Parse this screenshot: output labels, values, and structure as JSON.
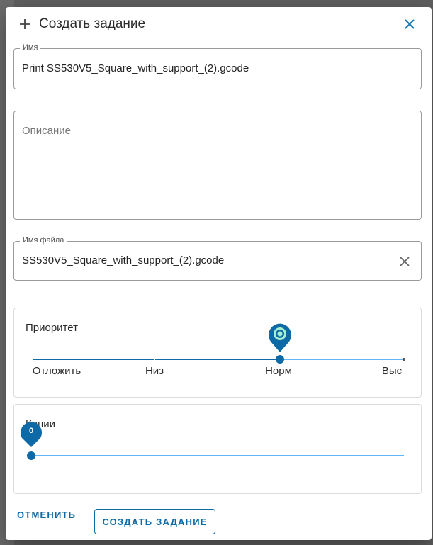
{
  "dialog": {
    "title": "Создать задание"
  },
  "fields": {
    "name": {
      "legend": "Имя",
      "value": "Print SS530V5_Square_with_support_(2).gcode"
    },
    "description": {
      "placeholder": "Описание",
      "value": ""
    },
    "filename": {
      "legend": "Имя файла",
      "value": "SS530V5_Square_with_support_(2).gcode"
    }
  },
  "priority": {
    "label": "Приоритет",
    "marks": [
      "Отложить",
      "Низ",
      "Норм",
      "Выс"
    ],
    "selected": "Норм",
    "level": 2
  },
  "copies": {
    "label": "Копии",
    "value": "0",
    "min": 0
  },
  "actions": {
    "cancel": "ОТМЕНИТЬ",
    "create": "СОЗДАТЬ ЗАДАНИЕ"
  },
  "colors": {
    "accent": "#0d6aa6",
    "track_light": "#64b5f6",
    "pin_inner": "#a5f0d0"
  },
  "icons": {
    "plus": "plus-icon",
    "close": "close-icon",
    "clear": "clear-icon",
    "pin": "location-pin-icon"
  }
}
